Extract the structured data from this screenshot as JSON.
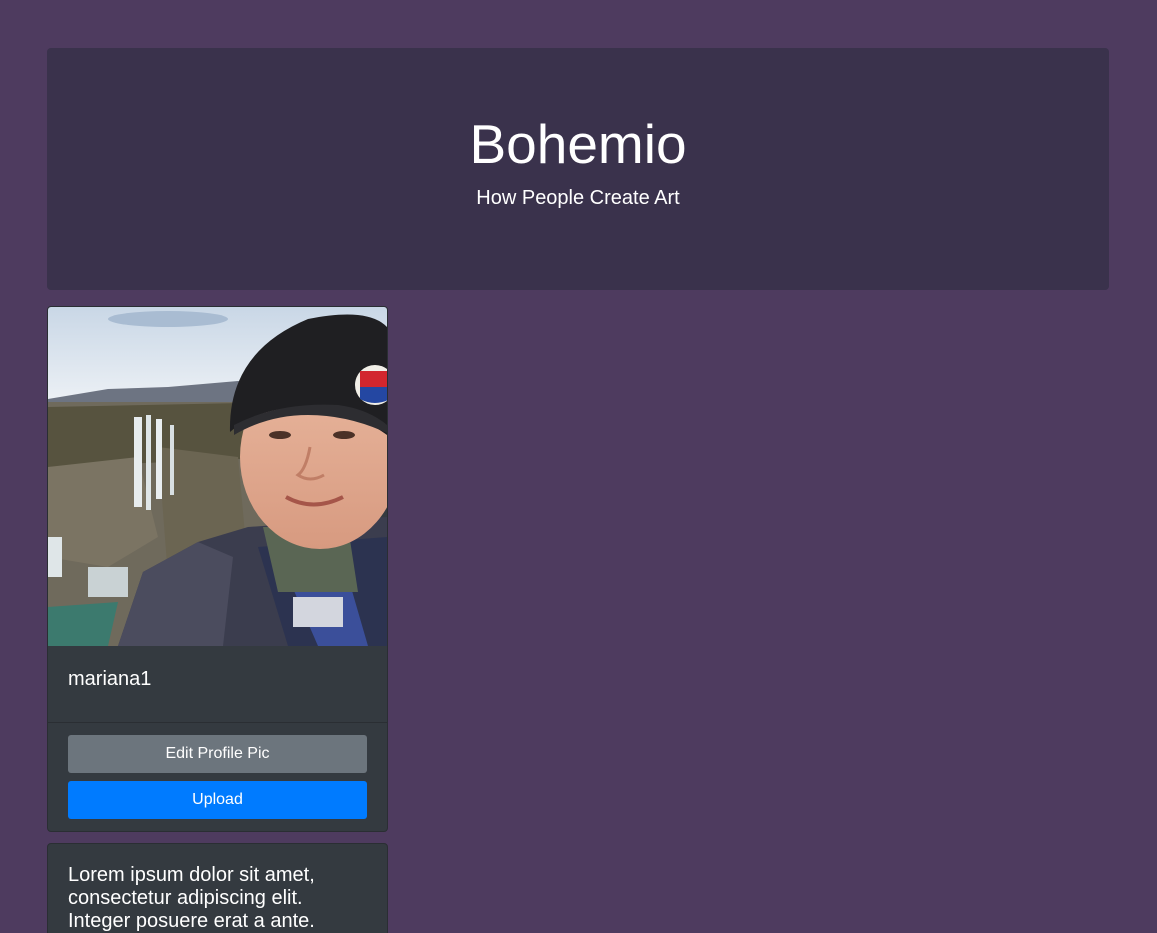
{
  "header": {
    "title": "Bohemio",
    "subtitle": "How People Create Art"
  },
  "profile": {
    "username": "mariana1",
    "photo_alt": "profile photo",
    "edit_button_label": "Edit Profile Pic",
    "upload_button_label": "Upload"
  },
  "bio": {
    "text": "Lorem ipsum dolor sit amet, consectetur adipiscing elit. Integer posuere erat a ante."
  },
  "colors": {
    "page_background": "#4e3b5f",
    "jumbotron_background": "#3a324c",
    "card_background": "#343a40",
    "secondary_button": "#6c757d",
    "primary_button": "#007bff"
  },
  "icons": {
    "profile_photo": "user-photo"
  }
}
